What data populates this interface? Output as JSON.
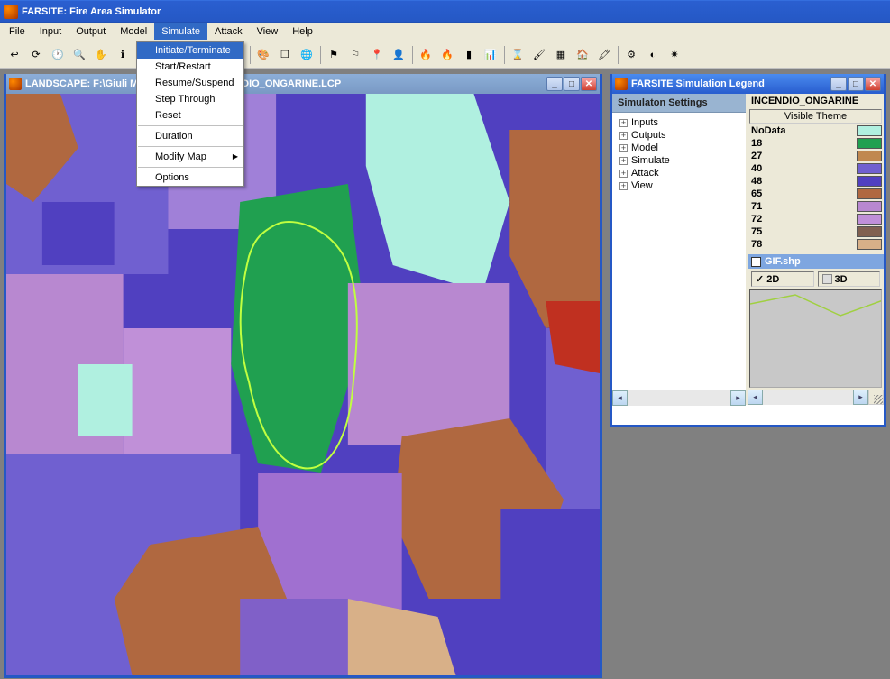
{
  "app": {
    "title": "FARSITE: Fire Area Simulator"
  },
  "menubar": {
    "items": [
      "File",
      "Input",
      "Output",
      "Model",
      "Simulate",
      "Attack",
      "View",
      "Help"
    ],
    "active": "Simulate"
  },
  "simulate_menu": {
    "items": [
      {
        "label": "Initiate/Terminate",
        "highlighted": true
      },
      {
        "label": "Start/Restart"
      },
      {
        "label": "Resume/Suspend"
      },
      {
        "label": "Step Through"
      },
      {
        "label": "Reset"
      },
      {
        "sep": true
      },
      {
        "label": "Duration"
      },
      {
        "sep": true
      },
      {
        "label": "Modify Map",
        "submenu": true
      },
      {
        "sep": true
      },
      {
        "label": "Options"
      }
    ]
  },
  "landscape_window": {
    "title": "LANDSCAPE: F:\\Giuli                                 Monte_Ongarine\\INCENDIO_ONGARINE.LCP"
  },
  "legend_window": {
    "title": "FARSITE Simulation Legend"
  },
  "settings": {
    "header": "Simulaton Settings",
    "tree": [
      "Inputs",
      "Outputs",
      "Model",
      "Simulate",
      "Attack",
      "View"
    ]
  },
  "legend": {
    "project": "INCENDIO_ONGARINE",
    "visible_theme": "Visible Theme",
    "rows": [
      {
        "label": "NoData",
        "color": "#b0f0e0"
      },
      {
        "label": "18",
        "color": "#20a050"
      },
      {
        "label": "27",
        "color": "#c08850"
      },
      {
        "label": "40",
        "color": "#7060d0"
      },
      {
        "label": "48",
        "color": "#5040c0"
      },
      {
        "label": "65",
        "color": "#b06840"
      },
      {
        "label": "71",
        "color": "#b888d0"
      },
      {
        "label": "72",
        "color": "#c090d8"
      },
      {
        "label": "75",
        "color": "#806050"
      },
      {
        "label": "78",
        "color": "#d8b088"
      }
    ],
    "shp": "GIF.shp",
    "mode_2d": "2D",
    "mode_3d": "3D"
  },
  "toolbar_icons": [
    "back",
    "reload",
    "clock",
    "zoom",
    "pan",
    "info",
    "sep",
    "rect",
    "save",
    "open",
    "print",
    "poly",
    "sep",
    "palette",
    "layers",
    "world",
    "sep",
    "flag1",
    "flag2",
    "pin",
    "person",
    "sep",
    "fire1",
    "fire2",
    "bars",
    "chart",
    "sep",
    "hourglass",
    "brush",
    "grid",
    "house",
    "paint",
    "sep",
    "gun",
    "shadow",
    "explode"
  ]
}
